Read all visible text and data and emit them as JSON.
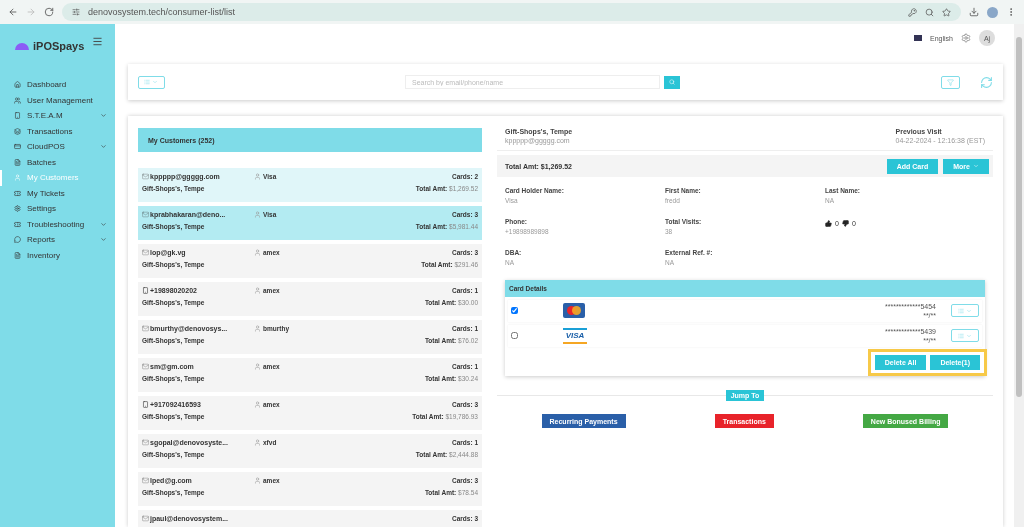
{
  "browser": {
    "url": "denovosystem.tech/consumer-list/list"
  },
  "sidebar": {
    "logo": "iPOSpays",
    "items": [
      {
        "label": "Dashboard",
        "selected": false,
        "expandable": false
      },
      {
        "label": "User Management",
        "selected": false,
        "expandable": false
      },
      {
        "label": "S.T.E.A.M",
        "selected": false,
        "expandable": true
      },
      {
        "label": "Transactions",
        "selected": false,
        "expandable": false
      },
      {
        "label": "CloudPOS",
        "selected": false,
        "expandable": true
      },
      {
        "label": "Batches",
        "selected": false,
        "expandable": false
      },
      {
        "label": "My Customers",
        "selected": true,
        "expandable": false
      },
      {
        "label": "My Tickets",
        "selected": false,
        "expandable": false
      },
      {
        "label": "Settings",
        "selected": false,
        "expandable": false
      },
      {
        "label": "Troubleshooting",
        "selected": false,
        "expandable": true
      },
      {
        "label": "Reports",
        "selected": false,
        "expandable": true
      },
      {
        "label": "Inventory",
        "selected": false,
        "expandable": false
      }
    ]
  },
  "header": {
    "language": "English",
    "avatar": "Aj"
  },
  "search": {
    "placeholder": "Search by email/phone/name"
  },
  "customers": {
    "title": "My Customers (252)",
    "rows": [
      {
        "contact": "kppppp@ggggg.com",
        "kind": "email",
        "card": "Visa",
        "cards": "Cards: 2",
        "store": "Gift-Shops's, Tempe",
        "total_label": "Total Amt:",
        "total": "$1,269.52",
        "selected": true,
        "hovered": false
      },
      {
        "contact": "kprabhakaran@deno...",
        "kind": "email",
        "card": "Visa",
        "cards": "Cards: 3",
        "store": "Gift-Shops's, Tempe",
        "total_label": "Total Amt:",
        "total": "$5,981.44",
        "selected": false,
        "hovered": true
      },
      {
        "contact": "lop@gk.vg",
        "kind": "email",
        "card": "amex",
        "cards": "Cards: 3",
        "store": "Gift-Shops's, Tempe",
        "total_label": "Total Amt:",
        "total": "$291.46",
        "selected": false,
        "hovered": false
      },
      {
        "contact": "+19898020202",
        "kind": "phone",
        "card": "amex",
        "cards": "Cards: 1",
        "store": "Gift-Shops's, Tempe",
        "total_label": "Total Amt:",
        "total": "$30.00",
        "selected": false,
        "hovered": false
      },
      {
        "contact": "bmurthy@denovosys...",
        "kind": "email",
        "card": "bmurthy",
        "cards": "Cards: 1",
        "store": "Gift-Shops's, Tempe",
        "total_label": "Total Amt:",
        "total": "$76.02",
        "selected": false,
        "hovered": false
      },
      {
        "contact": "sm@gm.com",
        "kind": "email",
        "card": "amex",
        "cards": "Cards: 1",
        "store": "Gift-Shops's, Tempe",
        "total_label": "Total Amt:",
        "total": "$30.24",
        "selected": false,
        "hovered": false
      },
      {
        "contact": "+917092416593",
        "kind": "phone",
        "card": "amex",
        "cards": "Cards: 3",
        "store": "Gift-Shops's, Tempe",
        "total_label": "Total Amt:",
        "total": "$19,786.93",
        "selected": false,
        "hovered": false
      },
      {
        "contact": "sgopal@denovosyste...",
        "kind": "email",
        "card": "xfvd",
        "cards": "Cards: 1",
        "store": "Gift-Shops's, Tempe",
        "total_label": "Total Amt:",
        "total": "$2,444.88",
        "selected": false,
        "hovered": false
      },
      {
        "contact": "lped@g.com",
        "kind": "email",
        "card": "amex",
        "cards": "Cards: 3",
        "store": "Gift-Shops's, Tempe",
        "total_label": "Total Amt:",
        "total": "$78.54",
        "selected": false,
        "hovered": false
      },
      {
        "contact": "jpaul@denovosystem...",
        "kind": "email",
        "cards": "Cards: 3",
        "selected": false,
        "hovered": false
      }
    ]
  },
  "detail": {
    "store": "Gift-Shops's, Tempe",
    "email": "kppppp@ggggg.com",
    "previous_visit_label": "Previous Visit",
    "previous_visit": "04-22-2024 - 12:16:38 (EST)",
    "total": "Total Amt: $1,269.52",
    "add_card": "Add Card",
    "more": "More",
    "fields": [
      {
        "label": "Card Holder Name:",
        "value": "Visa"
      },
      {
        "label": "First Name:",
        "value": "fredd"
      },
      {
        "label": "Last Name:",
        "value": "NA"
      },
      {
        "label": "Phone:",
        "value": "+19898989898"
      },
      {
        "label": "Total Visits:",
        "value": "38"
      },
      {
        "kind": "votes",
        "up": "0",
        "down": "0"
      },
      {
        "label": "DBA:",
        "value": "NA"
      },
      {
        "label": "External Ref. #:",
        "value": "NA"
      }
    ],
    "card_details": {
      "title": "Card Details",
      "cards": [
        {
          "kind": "mastercard",
          "number": "*************5454",
          "expiry": "**/**",
          "checked": true
        },
        {
          "kind": "visa",
          "brand_text": "VISA",
          "number": "*************5439",
          "expiry": "**/**",
          "checked": false
        }
      ],
      "delete_all": "Delete All",
      "delete_selected": "Delete(1)"
    },
    "jump_to": "Jump To",
    "links": [
      {
        "label": "Recurring Payments",
        "color": "#2a5fa8"
      },
      {
        "label": "Transactions",
        "color": "#e8232a"
      },
      {
        "label": "New Bonused Billing",
        "color": "#44a844"
      }
    ]
  }
}
